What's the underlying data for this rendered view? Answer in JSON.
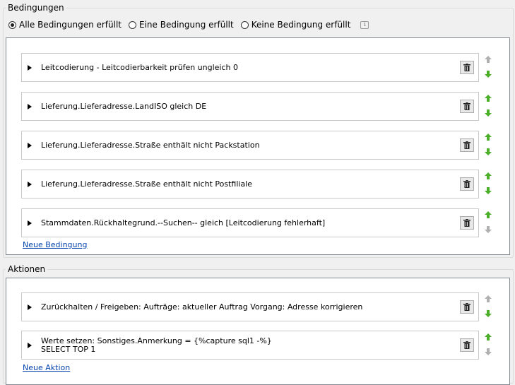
{
  "bedingungen": {
    "title": "Bedingungen",
    "radios": [
      {
        "label": "Alle Bedingungen erfüllt",
        "checked": true
      },
      {
        "label": "Eine Bedingung erfüllt",
        "checked": false
      },
      {
        "label": "Keine Bedingung erfüllt",
        "checked": false
      }
    ],
    "info_icon_glyph": "i",
    "conditions": [
      {
        "label": "Leitcodierung - Leitcodierbarkeit prüfen ungleich 0",
        "up_enabled": false,
        "down_enabled": true
      },
      {
        "label": "Lieferung.Lieferadresse.LandISO gleich DE",
        "up_enabled": true,
        "down_enabled": true
      },
      {
        "label": "Lieferung.Lieferadresse.Straße enthält nicht Packstation",
        "up_enabled": true,
        "down_enabled": true
      },
      {
        "label": "Lieferung.Lieferadresse.Straße enthält nicht Postfiliale",
        "up_enabled": true,
        "down_enabled": true
      },
      {
        "label": "Stammdaten.Rückhaltegrund.--Suchen-- gleich [Leitcodierung fehlerhaft]",
        "up_enabled": true,
        "down_enabled": false
      }
    ],
    "new_link": "Neue Bedingung"
  },
  "aktionen": {
    "title": "Aktionen",
    "actions": [
      {
        "label": "Zurückhalten / Freigeben: Aufträge: aktueller Auftrag Vorgang: Adresse korrigieren",
        "up_enabled": false,
        "down_enabled": true
      },
      {
        "label": "Werte setzen: Sonstiges.Anmerkung = {%capture sql1 -%}\nSELECT TOP 1",
        "up_enabled": true,
        "down_enabled": false
      }
    ],
    "new_link": "Neue Aktion"
  },
  "colors": {
    "arrow_enabled": "#4caf2a",
    "arrow_disabled": "#b0b0b0"
  },
  "icons": {
    "delete": "trash-icon",
    "expand": "expand-triangle-icon",
    "up": "arrow-up-icon",
    "down": "arrow-down-icon"
  }
}
